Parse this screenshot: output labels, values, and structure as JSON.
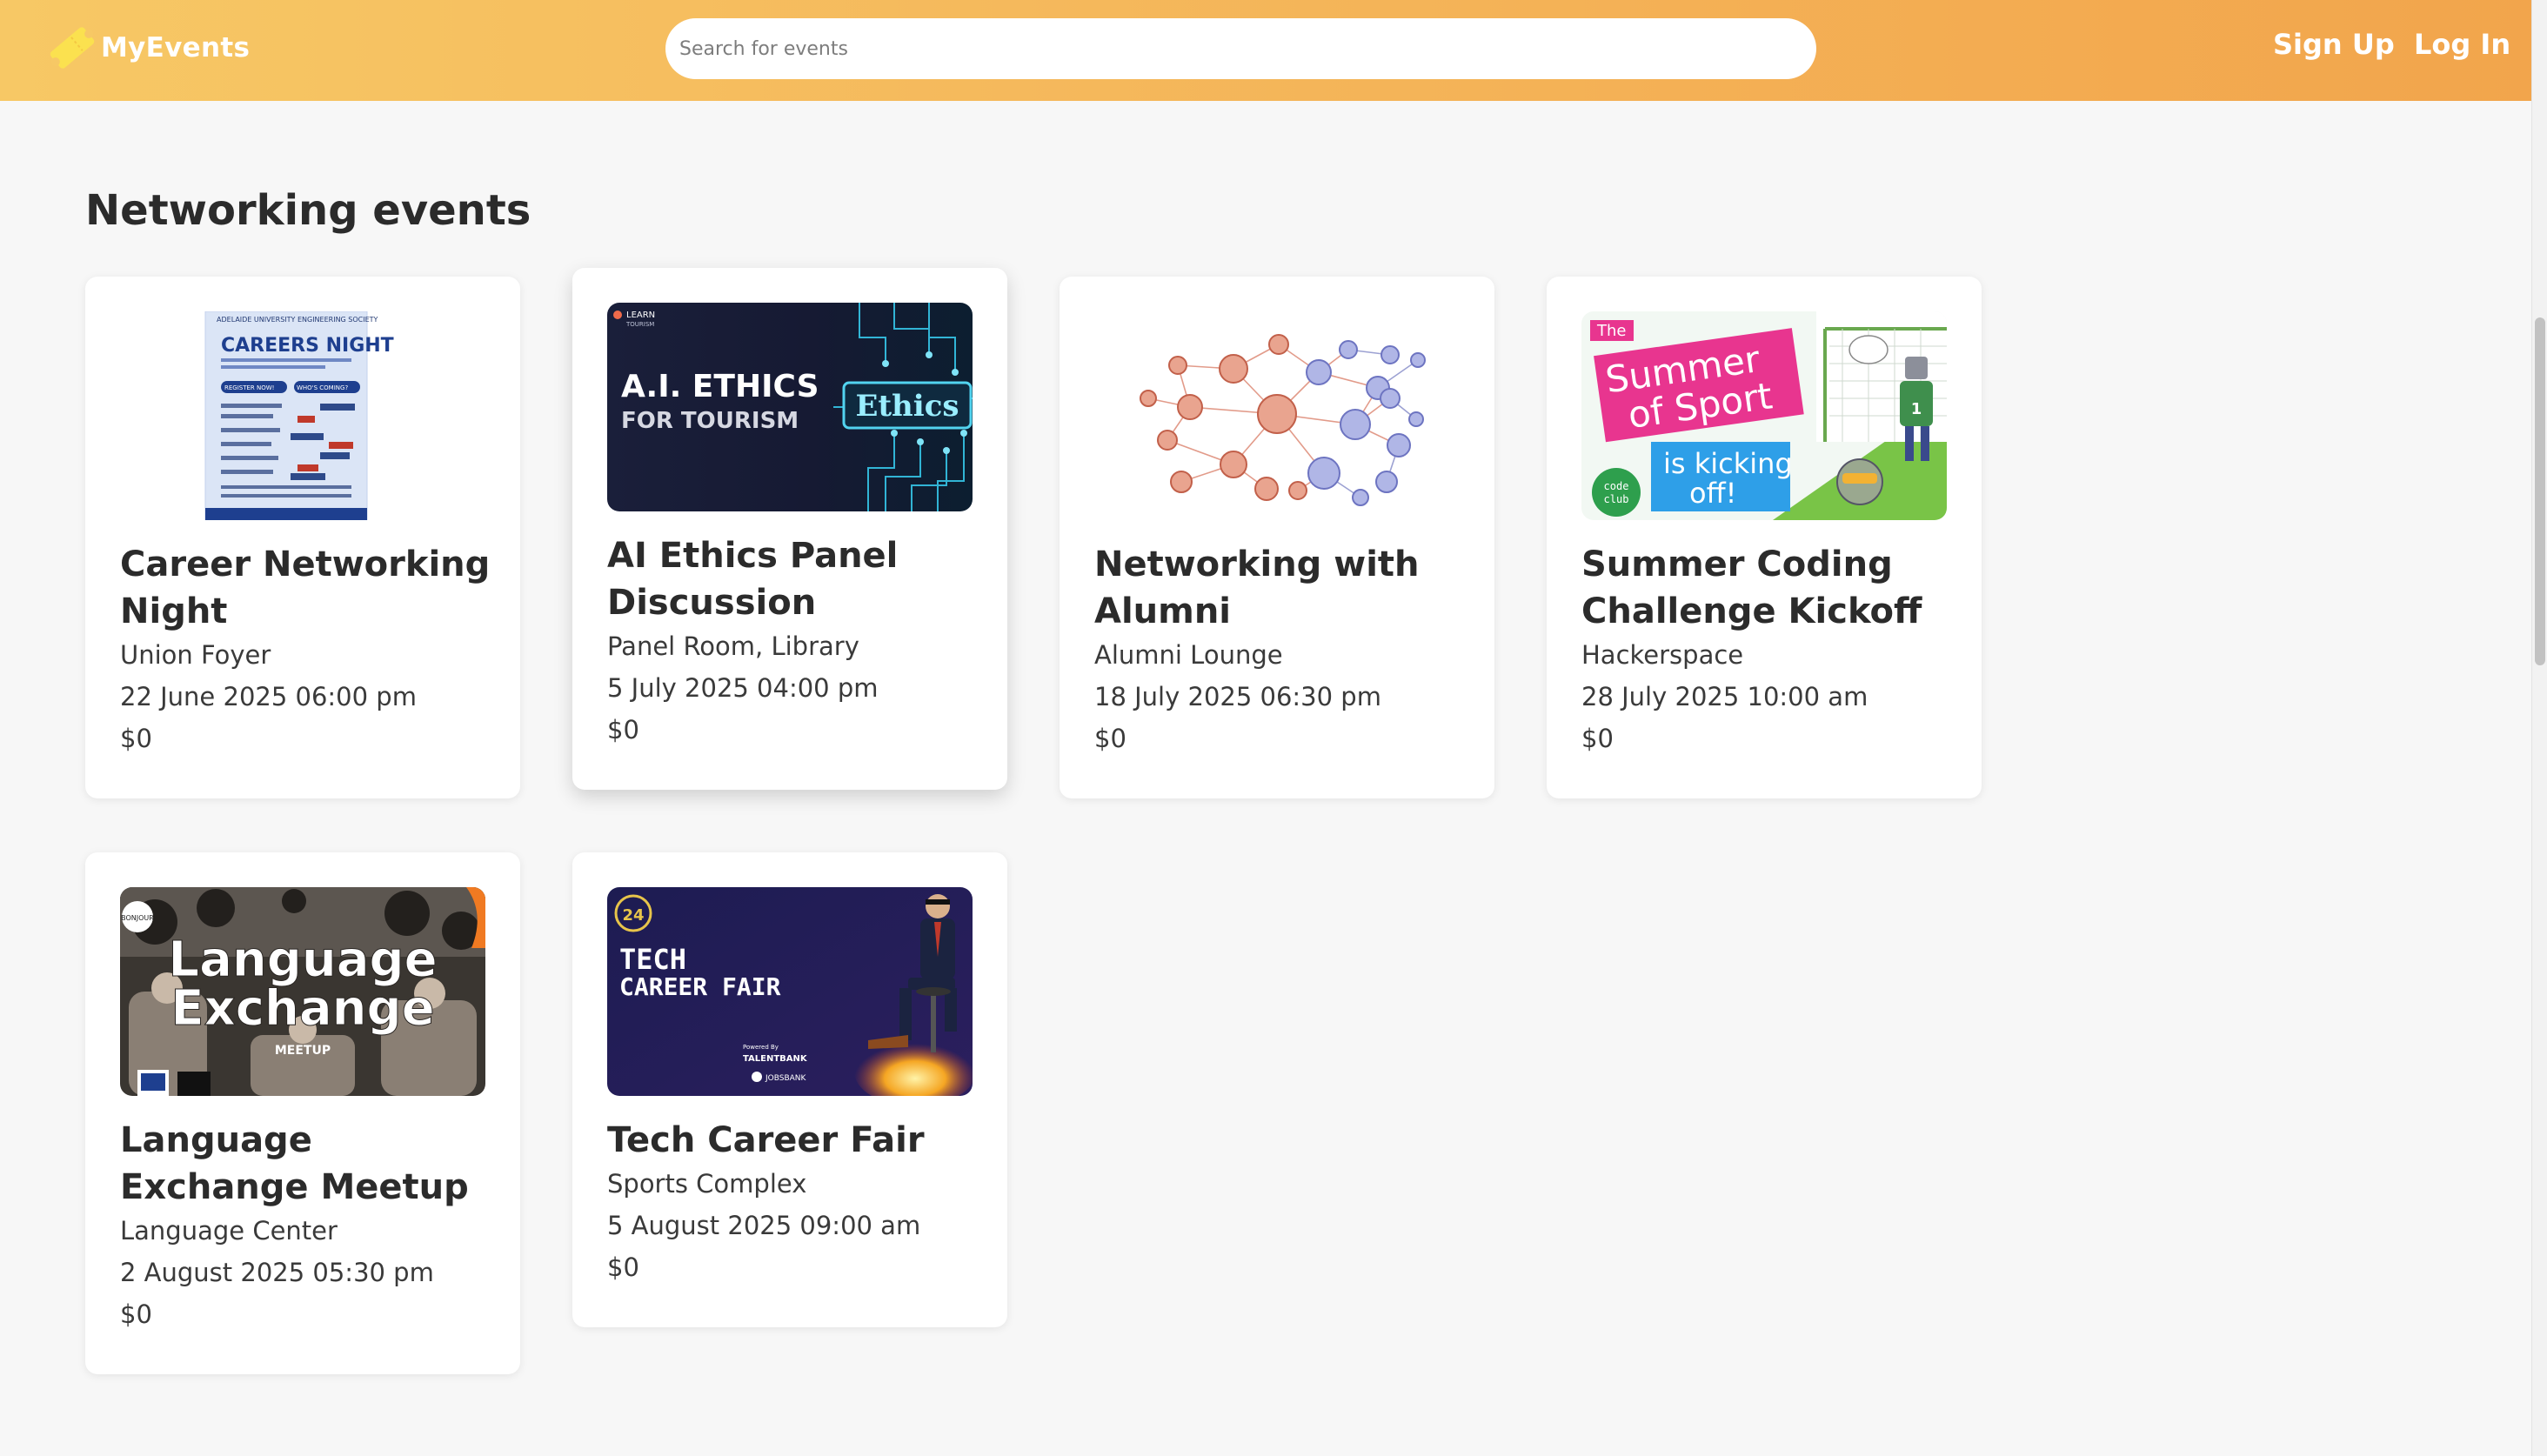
{
  "nav": {
    "brand": "MyEvents",
    "search_placeholder": "Search for events",
    "signup": "Sign Up",
    "login": "Log In"
  },
  "section_title": "Networking events",
  "events": [
    {
      "title": "Career Networking Night",
      "venue": "Union Foyer",
      "date": "22 June 2025 06:00 pm",
      "price": "$0",
      "poster": {
        "header": "ADELAIDE UNIVERSITY ENGINEERING SOCIETY",
        "heading": "CAREERS NIGHT",
        "button_1": "REGISTER NOW!",
        "button_2": "WHO'S COMING?"
      }
    },
    {
      "title": "AI Ethics Panel Discussion",
      "venue": "Panel Room, Library",
      "date": "5 July 2025 04:00 pm",
      "price": "$0",
      "poster": {
        "brand_line_1": "LEARN",
        "brand_line_2": "TOURISM",
        "heading": "A.I. ETHICS",
        "subheading": "FOR TOURISM",
        "sign": "Ethics"
      }
    },
    {
      "title": "Networking with Alumni",
      "venue": "Alumni Lounge",
      "date": "18 July 2025 06:30 pm",
      "price": "$0"
    },
    {
      "title": "Summer Coding Challenge Kickoff",
      "venue": "Hackerspace",
      "date": "28 July 2025 10:00 am",
      "price": "$0",
      "poster": {
        "the": "The",
        "line_1": "Summer",
        "line_2": "of Sport",
        "line_3": "is kicking",
        "line_4": "off!",
        "badge_1": "code",
        "badge_2": "club",
        "shirt_number": "1"
      }
    },
    {
      "title": "Language Exchange Meetup",
      "venue": "Language Center",
      "date": "2 August 2025 05:30 pm",
      "price": "$0",
      "poster": {
        "line_1": "Language",
        "line_2": "Exchange",
        "tagline": "MEETUP",
        "bubble": "BONJOUR"
      }
    },
    {
      "title": "Tech Career Fair",
      "venue": "Sports Complex",
      "date": "5 August 2025 09:00 am",
      "price": "$0",
      "poster": {
        "badge": "24",
        "line_1": "TECH",
        "line_2": "CAREER FAIR",
        "powered_by": "Powered By",
        "sponsor_1": "TALENTBANK",
        "sponsor_2": "JOBSBANK"
      }
    }
  ],
  "colors": {
    "nav_gradient_start": "#f7c865",
    "nav_gradient_end": "#f2a54c",
    "page_background": "#f7f7f7",
    "card_background": "#ffffff"
  }
}
